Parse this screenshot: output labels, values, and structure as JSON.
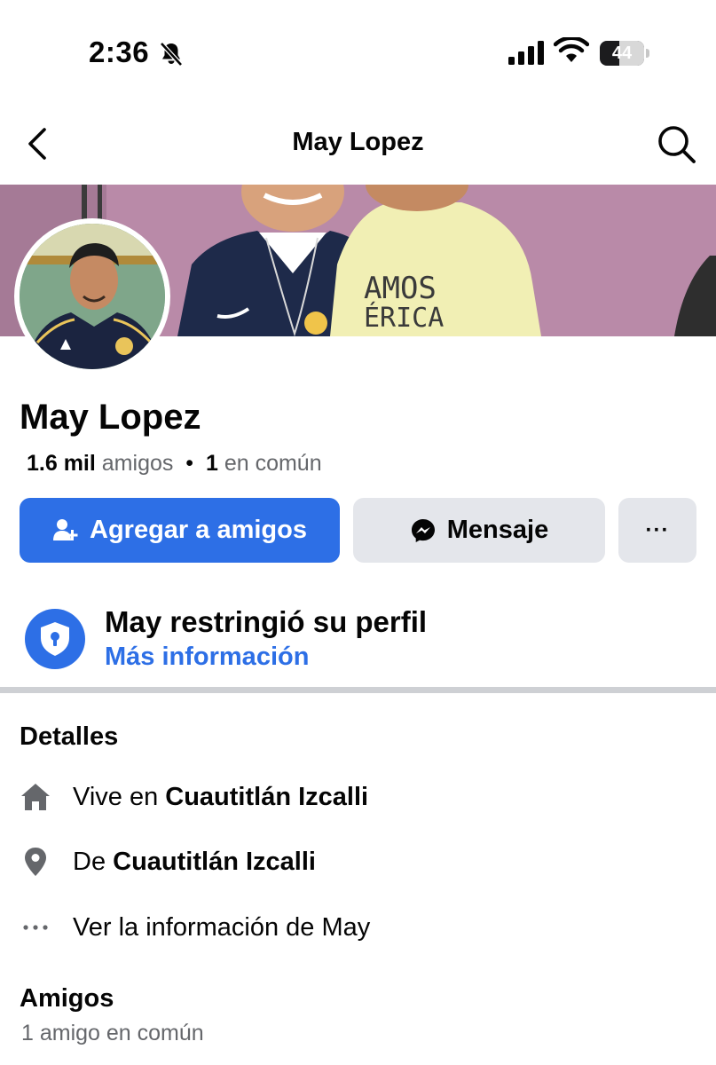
{
  "status_bar": {
    "time": "2:36",
    "battery_level": "44",
    "silent_mode": true
  },
  "nav": {
    "title": "May Lopez",
    "back_icon": "chevron-left-icon",
    "search_icon": "search-icon"
  },
  "profile": {
    "name": "May Lopez",
    "friends_count": "1.6 mil",
    "friends_label": "amigos",
    "separator": "•",
    "mutual_count": "1",
    "mutual_label": "en común"
  },
  "actions": {
    "add_friend_label": "Agregar a amigos",
    "message_label": "Mensaje",
    "more_label": "···"
  },
  "restriction": {
    "title": "May restringió su perfil",
    "link": "Más información"
  },
  "details": {
    "title": "Detalles",
    "lives_prefix": "Vive en ",
    "lives_place": "Cuautitlán Izcalli",
    "from_prefix": "De ",
    "from_place": "Cuautitlán Izcalli",
    "see_info": "Ver la información de May"
  },
  "friends_section": {
    "title": "Amigos",
    "subtitle": "1 amigo en común"
  },
  "colors": {
    "accent": "#2d6fe6",
    "secondary_button": "#e4e6eb",
    "muted_text": "#65676b",
    "cover_background": "#b98aa8"
  }
}
